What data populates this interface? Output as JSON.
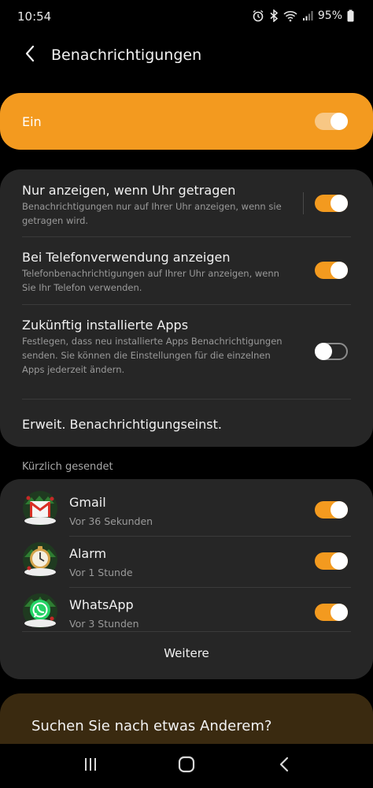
{
  "status_bar": {
    "time": "10:54",
    "battery": "95%"
  },
  "header": {
    "title": "Benachrichtigungen"
  },
  "master": {
    "label": "Ein",
    "enabled": true
  },
  "settings": [
    {
      "title": "Nur anzeigen, wenn Uhr getragen",
      "subtitle": "Benachrichtigungen nur auf Ihrer Uhr anzeigen, wenn sie getragen wird.",
      "enabled": true
    },
    {
      "title": "Bei Telefonverwendung anzeigen",
      "subtitle": "Telefonbenachrichtigungen auf Ihrer Uhr anzeigen, wenn Sie Ihr Telefon verwenden.",
      "enabled": true
    },
    {
      "title": "Zukünftig installierte Apps",
      "subtitle": "Festlegen, dass neu installierte Apps Benachrichtigungen senden. Sie können die Einstellungen für die einzelnen Apps jederzeit ändern.",
      "enabled": false
    },
    {
      "title": "Erweit. Benachrichtigungseinst."
    }
  ],
  "recent": {
    "label": "Kürzlich gesendet",
    "apps": [
      {
        "name": "Gmail",
        "time": "Vor 36 Sekunden",
        "icon": "gmail-icon",
        "enabled": true
      },
      {
        "name": "Alarm",
        "time": "Vor 1 Stunde",
        "icon": "alarm-clock-icon",
        "enabled": true
      },
      {
        "name": "WhatsApp",
        "time": "Vor 3 Stunden",
        "icon": "whatsapp-icon",
        "enabled": true
      }
    ],
    "more_label": "Weitere"
  },
  "search": {
    "text": "Suchen Sie nach etwas Anderem?"
  },
  "colors": {
    "accent": "#f39a1f",
    "card": "#262626",
    "background": "#000000"
  }
}
